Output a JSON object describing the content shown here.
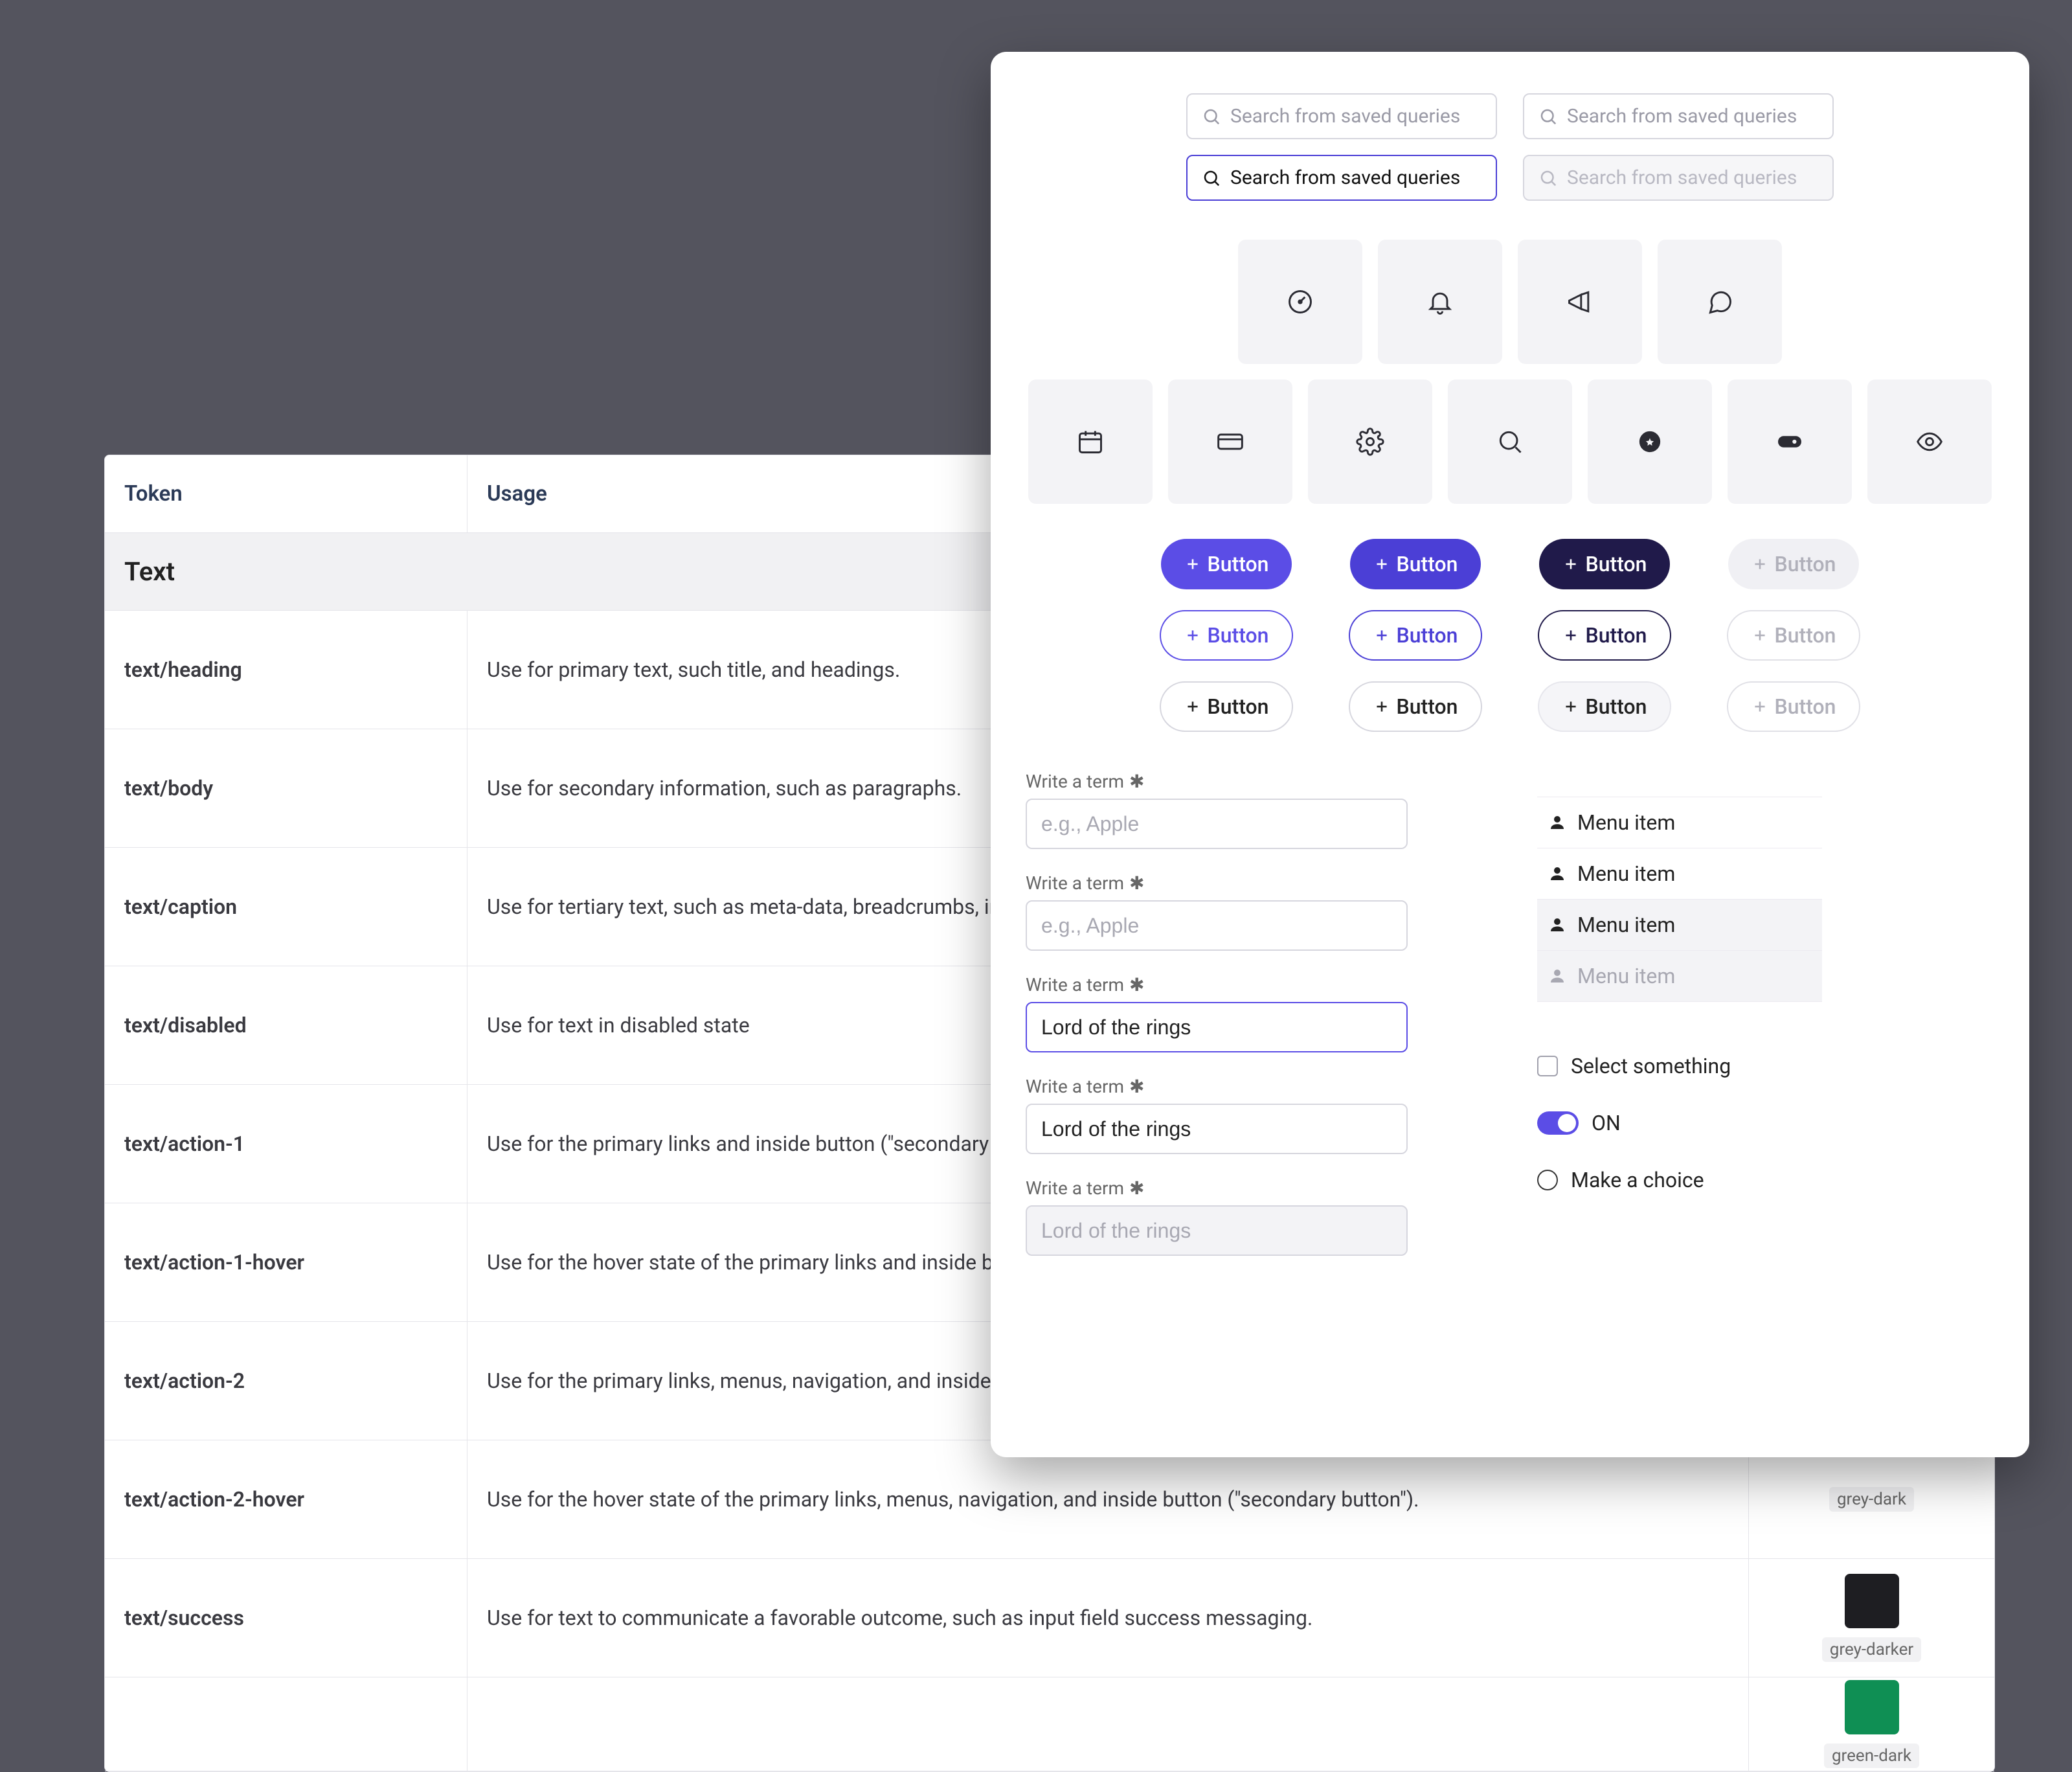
{
  "table": {
    "header_token": "Token",
    "header_usage": "Usage",
    "section": "Text",
    "rows": [
      {
        "token": "text/heading",
        "usage": "Use for primary text, such title, and headings."
      },
      {
        "token": "text/body",
        "usage": "Use for secondary information, such as paragraphs."
      },
      {
        "token": "text/caption",
        "usage": "Use for tertiary text, such as meta-data, breadcrumbs, input fiel"
      },
      {
        "token": "text/disabled",
        "usage": "Use for text in disabled state"
      },
      {
        "token": "text/action-1",
        "usage": "Use for the primary links and inside button (\"secondary button"
      },
      {
        "token": "text/action-1-hover",
        "usage": "Use for the hover state of the primary links and inside button ("
      },
      {
        "token": "text/action-2",
        "usage": "Use for the primary links, menus, navigation, and inside button"
      },
      {
        "token": "text/action-2-hover",
        "usage": "Use for the hover state of the primary links, menus, navigation, and inside button (\"secondary button\")."
      },
      {
        "token": "text/success",
        "usage": "Use for text to communicate a favorable outcome, such as input field success messaging."
      }
    ],
    "swatches": {
      "grey_dark": {
        "label": "grey-dark",
        "color": "#4a4a52"
      },
      "grey_darker": {
        "label": "grey-darker",
        "color": "#1e1e22"
      },
      "green_dark": {
        "label": "green-dark",
        "color": "#0f8f54"
      }
    }
  },
  "panel": {
    "search": {
      "default_placeholder": "Search from saved queries",
      "active_text": "Search from saved queries"
    },
    "button_label": "Button",
    "form": {
      "label": "Write a term",
      "placeholder": "e.g., Apple",
      "value": "Lord of the rings"
    },
    "menu": {
      "item_label": "Menu item"
    },
    "controls": {
      "checkbox": "Select something",
      "toggle": "ON",
      "radio": "Make a choice"
    }
  }
}
